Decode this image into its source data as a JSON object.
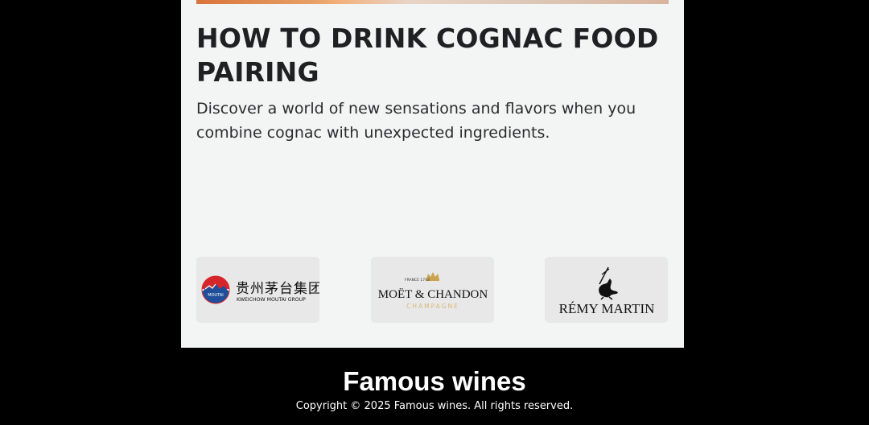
{
  "article": {
    "title": "HOW TO DRINK COGNAC FOOD PAIRING",
    "description": "Discover a world of new sensations and flavors when you combine cognac with unexpected ingredients."
  },
  "brands": [
    {
      "name": "moutai",
      "logo_text_cn": "贵州茅台集团",
      "logo_text_en": "KWEICHOW MOUTAI GROUP",
      "logo_badge": "MOUTAI"
    },
    {
      "name": "moet",
      "logo_top": "FRANCE  1743",
      "logo_main": "MOËT & CHANDON",
      "logo_sub": "CHAMPAGNE"
    },
    {
      "name": "remy",
      "logo_main": "RÉMY MARTIN"
    }
  ],
  "footer": {
    "title": "Famous wines",
    "copyright": "Copyright © 2025 Famous wines. All rights reserved."
  },
  "colors": {
    "page_bg": "#000000",
    "card_bg": "#f3f5f4",
    "brand_tile_bg": "#e8e8e8",
    "text_dark": "#1e2022",
    "moutai_red": "#d7262b",
    "moutai_blue": "#1f4e9a",
    "moet_gold": "#c9a44c"
  }
}
